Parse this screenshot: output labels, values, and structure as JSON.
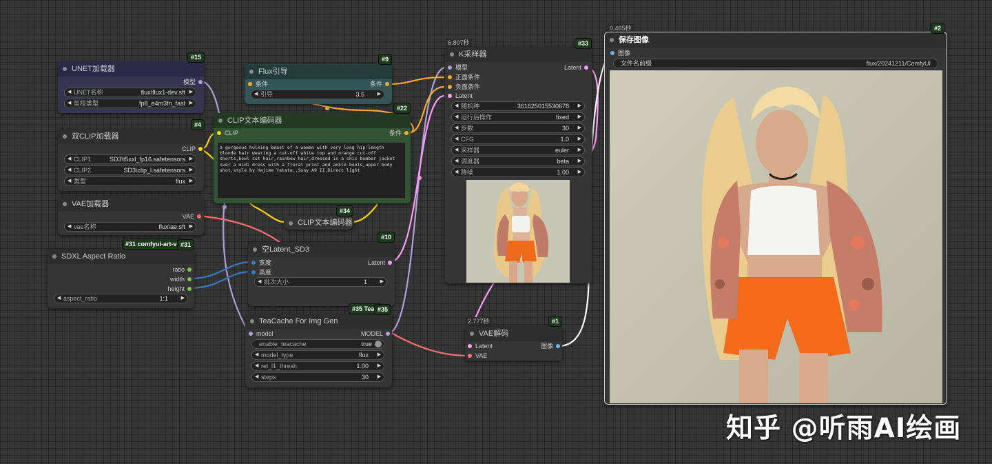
{
  "nodes": {
    "unet": {
      "title": "UNET加载器",
      "id": "#15",
      "out_model": "模型",
      "w_name_label": "UNET名称",
      "w_name_value": "flux\\flux1-dev.sft",
      "w_dtype_label": "剪枝类型",
      "w_dtype_value": "fp8_e4m3fn_fast"
    },
    "dualclip": {
      "title": "双CLIP加载器",
      "id": "#4",
      "out_clip": "CLIP",
      "w_clip1_label": "CLIP1",
      "w_clip1_value": "SD3\\t5xxl_fp16.safetensors",
      "w_clip2_label": "CLIP2",
      "w_clip2_value": "SD3\\clip_l.safetensors",
      "w_type_label": "类型",
      "w_type_value": "flux"
    },
    "vae_loader": {
      "title": "VAE加载器",
      "out_vae": "VAE",
      "w_label": "vae名称",
      "w_value": "flux\\ae.sft"
    },
    "sdxl": {
      "title": "SDXL Aspect Ratio",
      "id_full": "#31 comfyui-art-ve",
      "id": "#31",
      "out_ratio": "ratio",
      "out_width": "width",
      "out_height": "height",
      "w_label": "aspect_ratio",
      "w_value": "1:1"
    },
    "flux_guide": {
      "title": "Flux引导",
      "id": "#9",
      "in_cond": "条件",
      "out_cond": "条件",
      "w_label": "引导",
      "w_value": "3.5"
    },
    "clip_encode": {
      "title": "CLIP文本编码器",
      "id": "#22",
      "in_clip": "CLIP",
      "out_cond": "条件",
      "prompt": "a gorgeous hulking beast of a woman with very long hip-length blonde hair wearing a cut-off white top and orange cut-off shorts,bowl cut hair,rainbow hair,dressed in a chic bomber jacket over a midi dress with a floral print and ankle boots,upper body shot,style by Hajime Yatate,,Sony A9 II,Direct light"
    },
    "clip_encode2": {
      "title": "CLIP文本编码器",
      "id": "#34"
    },
    "empty_latent": {
      "title": "空Latent_SD3",
      "id": "#10",
      "in_width": "宽度",
      "in_height": "高度",
      "out_latent": "Latent",
      "w_label": "批次大小",
      "w_value": "1"
    },
    "teacache": {
      "title": "TeaCache For Img Gen",
      "id_full": "#35 TeaC",
      "id": "#35",
      "in_model": "model",
      "out_model": "MODEL",
      "w1_label": "enable_teacache",
      "w1_value": "true",
      "w2_label": "model_type",
      "w2_value": "flux",
      "w3_label": "rel_l1_thresh",
      "w3_value": "1.00",
      "w4_label": "steps",
      "w4_value": "30"
    },
    "ksampler": {
      "title": "K采样器",
      "id": "#33",
      "time": "6.807秒",
      "in_model": "模型",
      "in_pos": "正面条件",
      "in_neg": "负面条件",
      "in_latent": "Latent",
      "out_latent": "Latent",
      "widgets": [
        {
          "label": "随机种",
          "value": "361625015530678"
        },
        {
          "label": "运行后操作",
          "value": "fixed"
        },
        {
          "label": "步数",
          "value": "30"
        },
        {
          "label": "CFG",
          "value": "1.0"
        },
        {
          "label": "采样器",
          "value": "euler"
        },
        {
          "label": "调度器",
          "value": "beta"
        },
        {
          "label": "降噪",
          "value": "1.00"
        }
      ]
    },
    "vae_decode": {
      "title": "VAE解码",
      "id": "#1",
      "time": "2.777秒",
      "in_latent": "Latent",
      "in_vae": "VAE",
      "out_image": "图像"
    },
    "save_image": {
      "title": "保存图像",
      "id": "#2",
      "time": "0.465秒",
      "in_image": "图像",
      "w_label": "文件名前缀",
      "w_value": "flux/20241211/ComfyUI"
    }
  },
  "watermark": "知乎 @听雨AI绘画",
  "colors": {
    "model": "#b39ddb",
    "clip": "#ffd500",
    "cond": "#ffa931",
    "latent": "#ff9cf9",
    "vae": "#ff6e6e",
    "image": "#64b5f6",
    "int": "#7ec852"
  }
}
